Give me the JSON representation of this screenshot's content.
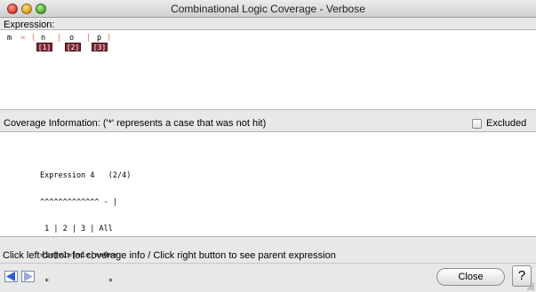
{
  "window": {
    "title": "Combinational Logic Coverage - Verbose"
  },
  "expression_section": {
    "label": "Expression:",
    "tokens": [
      "m",
      "=",
      "(",
      "n",
      "|",
      "o",
      "|",
      "p",
      ")"
    ],
    "badges": [
      "[1]",
      "[2]",
      "[3]"
    ]
  },
  "coverage_section": {
    "label": "Coverage Information:  ('*' represents a case that was not hit)",
    "excluded_label": "Excluded",
    "report_lines": [
      "Expression 4   (2/4)",
      "^^^^^^^^^^^^^ - |",
      " 1 | 2 | 3 | All",
      "=1=|=1=|=1=|==0==",
      " *             *"
    ]
  },
  "status": {
    "text": "Click left button for coverage info / Click right button to see parent expression"
  },
  "buttons": {
    "close_label": "Close",
    "help_label": "?"
  },
  "colors": {
    "badge": "#7b2733",
    "operator": "#e07050",
    "nav_arrow": "#2f5bd8"
  }
}
